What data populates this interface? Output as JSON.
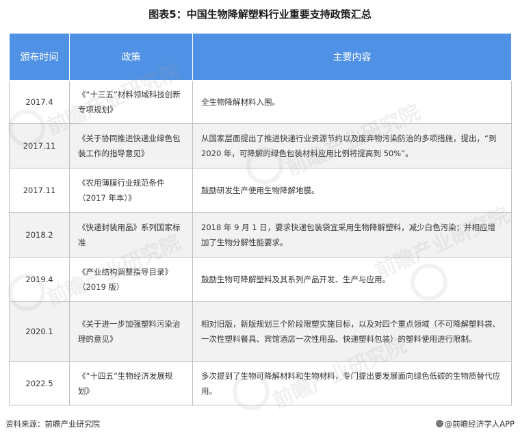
{
  "title": "图表5：中国生物降解塑料行业重要支持政策汇总",
  "table": {
    "headers": [
      "颁布时间",
      "政策",
      "主要内容"
    ],
    "rows": [
      {
        "date": "2017.4",
        "policy": "《“十三五”材料领域科技创新专项规划》",
        "content": "全生物降解材料入围。"
      },
      {
        "date": "2017.11",
        "policy": "《关于协同推进快递业绿色包装工作的指导意见》",
        "content": "从国家层面提出了推进快递行业资源节约以及废弃物污染防治的多项措施，提出，“到 2020 年，可降解的绿色包装材料应用比例将提高到 50%”。"
      },
      {
        "date": "2017.11",
        "policy": "《农用薄膜行业规范条件（2017 年本）》",
        "content": "鼓励研发生产使用生物降解地膜。"
      },
      {
        "date": "2018.2",
        "policy": "《快递封装用品》系列国家标准",
        "content": "2018 年 9 月 1 日，要求快递包装袋宜采用生物降解塑料，减少白色污染；并相应增加了生物分解性能要求。"
      },
      {
        "date": "2019.4",
        "policy": "《产业结构调整指导目录》（2019 版）",
        "content": "鼓励生物可降解塑料及其系列产品开发、生产与应用。"
      },
      {
        "date": "2020.1",
        "policy": "《关于进一步加强塑料污染治理的意见》",
        "content": "相对旧版，新版规划三个阶段限塑实施目标，以及对四个重点领域（不可降解塑料袋、一次性塑料餐具、宾馆酒店一次性用品、快递塑料包装）的塑料使用进行限制。"
      },
      {
        "date": "2022.5",
        "policy": "《“十四五”生物经济发展规划》",
        "content": "多次提到了生物可降解材料和生物材料，专门提出要发展面向绿色低碳的生物质替代应用。"
      }
    ]
  },
  "footer": {
    "source": "资料来源：前瞻产业研究院",
    "brand": "@前瞻经济学人APP"
  },
  "watermark_text": "前瞻产业研究院",
  "colors": {
    "header_bg": "#4f91e4",
    "row_alt_bg": "#f2f2f2",
    "border": "#bfbfbf"
  }
}
